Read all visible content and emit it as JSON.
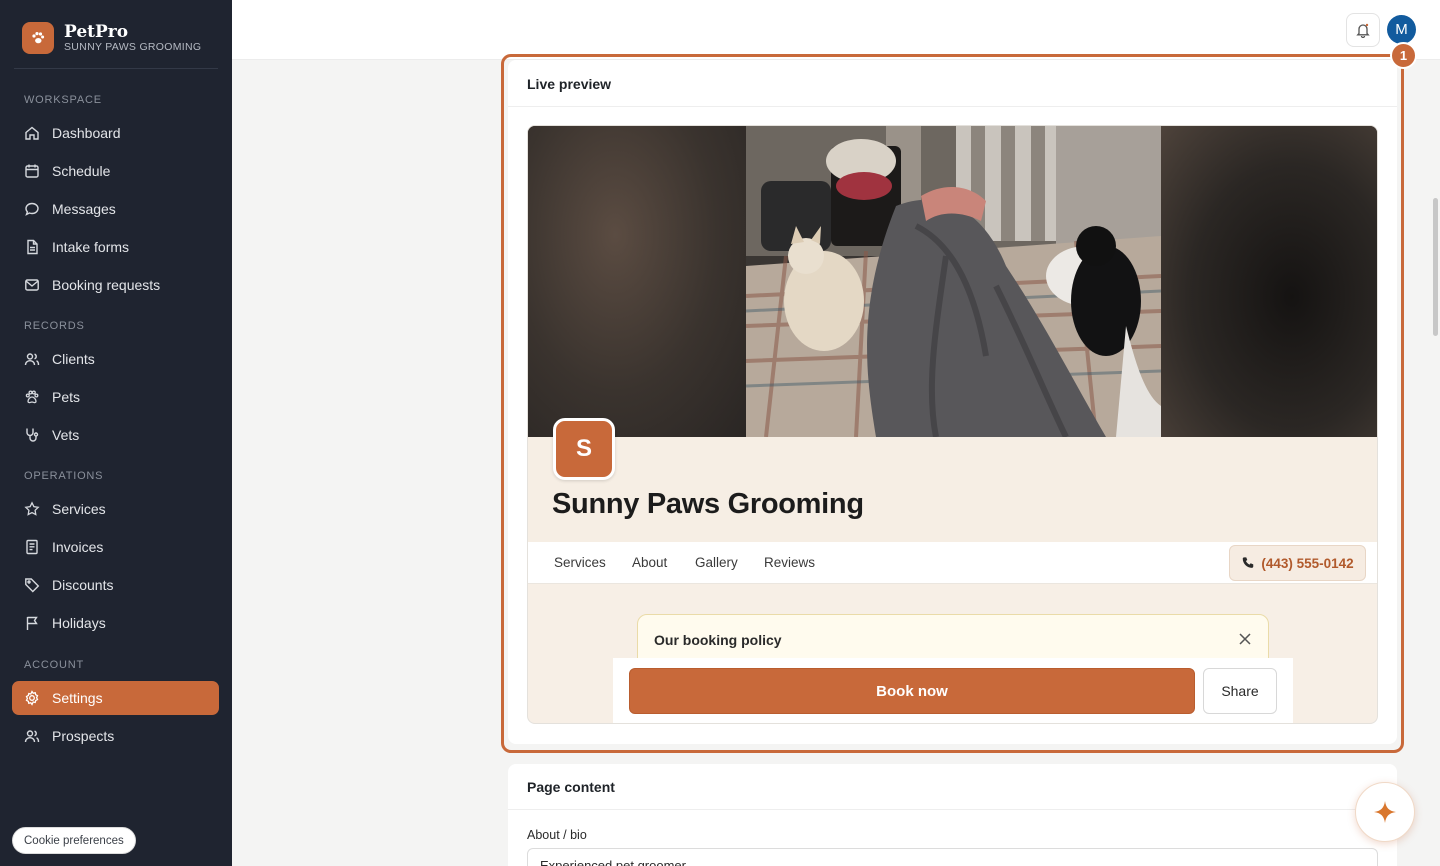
{
  "brand": {
    "name": "PetPro",
    "subtitle": "SUNNY PAWS GROOMING"
  },
  "sidebar": {
    "sections": {
      "workspace": "WORKSPACE",
      "records": "RECORDS",
      "operations": "OPERATIONS",
      "account": "ACCOUNT"
    },
    "items": {
      "dashboard": "Dashboard",
      "schedule": "Schedule",
      "messages": "Messages",
      "intake_forms": "Intake forms",
      "booking_requests": "Booking requests",
      "clients": "Clients",
      "pets": "Pets",
      "vets": "Vets",
      "services": "Services",
      "invoices": "Invoices",
      "discounts": "Discounts",
      "holidays": "Holidays",
      "settings": "Settings",
      "prospects": "Prospects"
    },
    "active": "Settings",
    "cookie_label": "Cookie preferences"
  },
  "topbar": {
    "avatar_initial": "M",
    "notification_badge": "1"
  },
  "preview": {
    "title": "Live preview",
    "logo_initial": "S",
    "business_name": "Sunny Paws Grooming",
    "nav": [
      "Services",
      "About",
      "Gallery",
      "Reviews"
    ],
    "phone": "(443) 555-0142",
    "policy_title": "Our booking policy",
    "book_label": "Book now",
    "share_label": "Share"
  },
  "page_content": {
    "title": "Page content",
    "about_label": "About / bio",
    "about_value": "Experienced pet groomer"
  },
  "colors": {
    "accent": "#c8693a",
    "sidebar_bg": "#1f2430",
    "avatar": "#125b9e"
  },
  "icons": [
    "paw-icon",
    "home-icon",
    "calendar-icon",
    "chat-icon",
    "document-icon",
    "mail-icon",
    "users-icon",
    "paw-icon",
    "stethoscope-icon",
    "star-icon",
    "receipt-icon",
    "tag-icon",
    "flag-icon",
    "gear-icon",
    "users-icon",
    "bell-icon",
    "phone-icon",
    "close-icon",
    "sparkle-icon"
  ]
}
